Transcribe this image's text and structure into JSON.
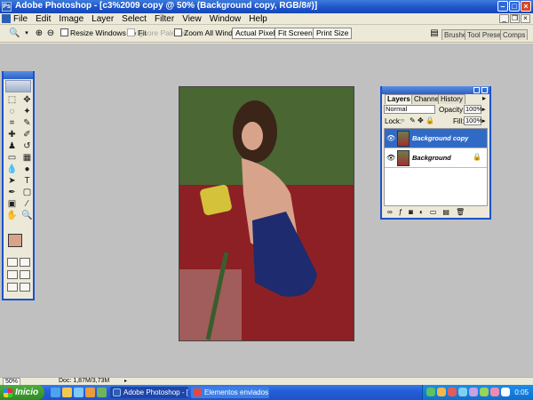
{
  "window": {
    "title": "Adobe Photoshop - [c3%2009 copy @ 50% (Background copy, RGB/8#)]"
  },
  "menu": {
    "items": [
      "File",
      "Edit",
      "Image",
      "Layer",
      "Select",
      "Filter",
      "View",
      "Window",
      "Help"
    ]
  },
  "options_bar": {
    "resize_windows": "Resize Windows To Fit",
    "ignore_palettes": "Ignore Palettes",
    "zoom_all": "Zoom All Windows",
    "actual_pixels": "Actual Pixels",
    "fit_screen": "Fit Screen",
    "print_size": "Print Size"
  },
  "palette_well": {
    "tabs": [
      "Brushes",
      "Tool Presets",
      "Comps"
    ]
  },
  "layers_panel": {
    "tabs": [
      "Layers",
      "Channels",
      "History"
    ],
    "blend_mode": "Normal",
    "opacity_label": "Opacity:",
    "opacity_value": "100%",
    "lock_label": "Lock:",
    "fill_label": "Fill:",
    "fill_value": "100%",
    "layers": [
      {
        "name": "Background copy",
        "selected": true
      },
      {
        "name": "Background",
        "selected": false
      }
    ]
  },
  "status_bar": {
    "zoom": "50%",
    "doc_info": "Doc: 1,87M/3,73M"
  },
  "taskbar": {
    "start_label": "Inicio",
    "tasks": [
      "Adobe Photoshop - [c...",
      "Elementos enviados - ..."
    ],
    "clock": "0:05"
  },
  "colors": {
    "foreground": "#d7a38b",
    "background": "#ffffff",
    "xp_blue": "#1c52c9",
    "selection": "#316ac5"
  }
}
